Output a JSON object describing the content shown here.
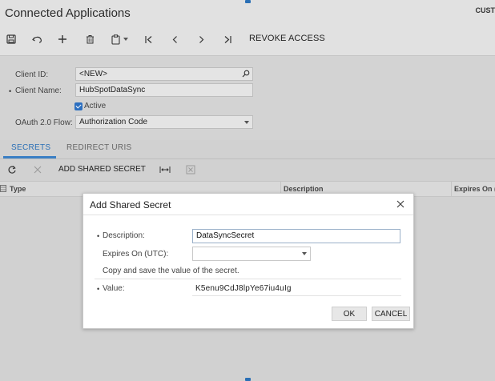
{
  "header": {
    "title": "Connected Applications",
    "corner_text": "CUST"
  },
  "toolbar": {
    "icons": [
      "save-icon",
      "undo-icon",
      "add-icon",
      "delete-icon",
      "clipboard-icon",
      "first-record-icon",
      "previous-icon",
      "next-icon",
      "last-record-icon"
    ],
    "revoke_label": "REVOKE ACCESS"
  },
  "form": {
    "client_id_label": "Client ID:",
    "client_id_value": "<NEW>",
    "client_name_label": "Client Name:",
    "client_name_value": "HubSpotDataSync",
    "active_label": "Active",
    "flow_label": "OAuth 2.0 Flow:",
    "flow_value": "Authorization Code",
    "required_mark": "•"
  },
  "tabs": [
    {
      "label": "SECRETS",
      "active": true
    },
    {
      "label": "REDIRECT URIS",
      "active": false
    }
  ],
  "grid": {
    "add_label": "ADD SHARED SECRET",
    "columns": [
      "Type",
      "Description",
      "Expires On ("
    ]
  },
  "dialog": {
    "title": "Add Shared Secret",
    "description_label": "Description:",
    "description_value": "DataSyncSecret",
    "expires_label": "Expires On (UTC):",
    "expires_value": "",
    "hint": "Copy and save the value of the secret.",
    "value_label": "Value:",
    "value_text": "K5enu9CdJ8lpYe67iu4uIg",
    "ok_label": "OK",
    "cancel_label": "CANCEL"
  },
  "colors": {
    "accent": "#2a6fb5",
    "header_bg": "#e1e1e1",
    "overlay_bg": "#d1d1d1"
  }
}
